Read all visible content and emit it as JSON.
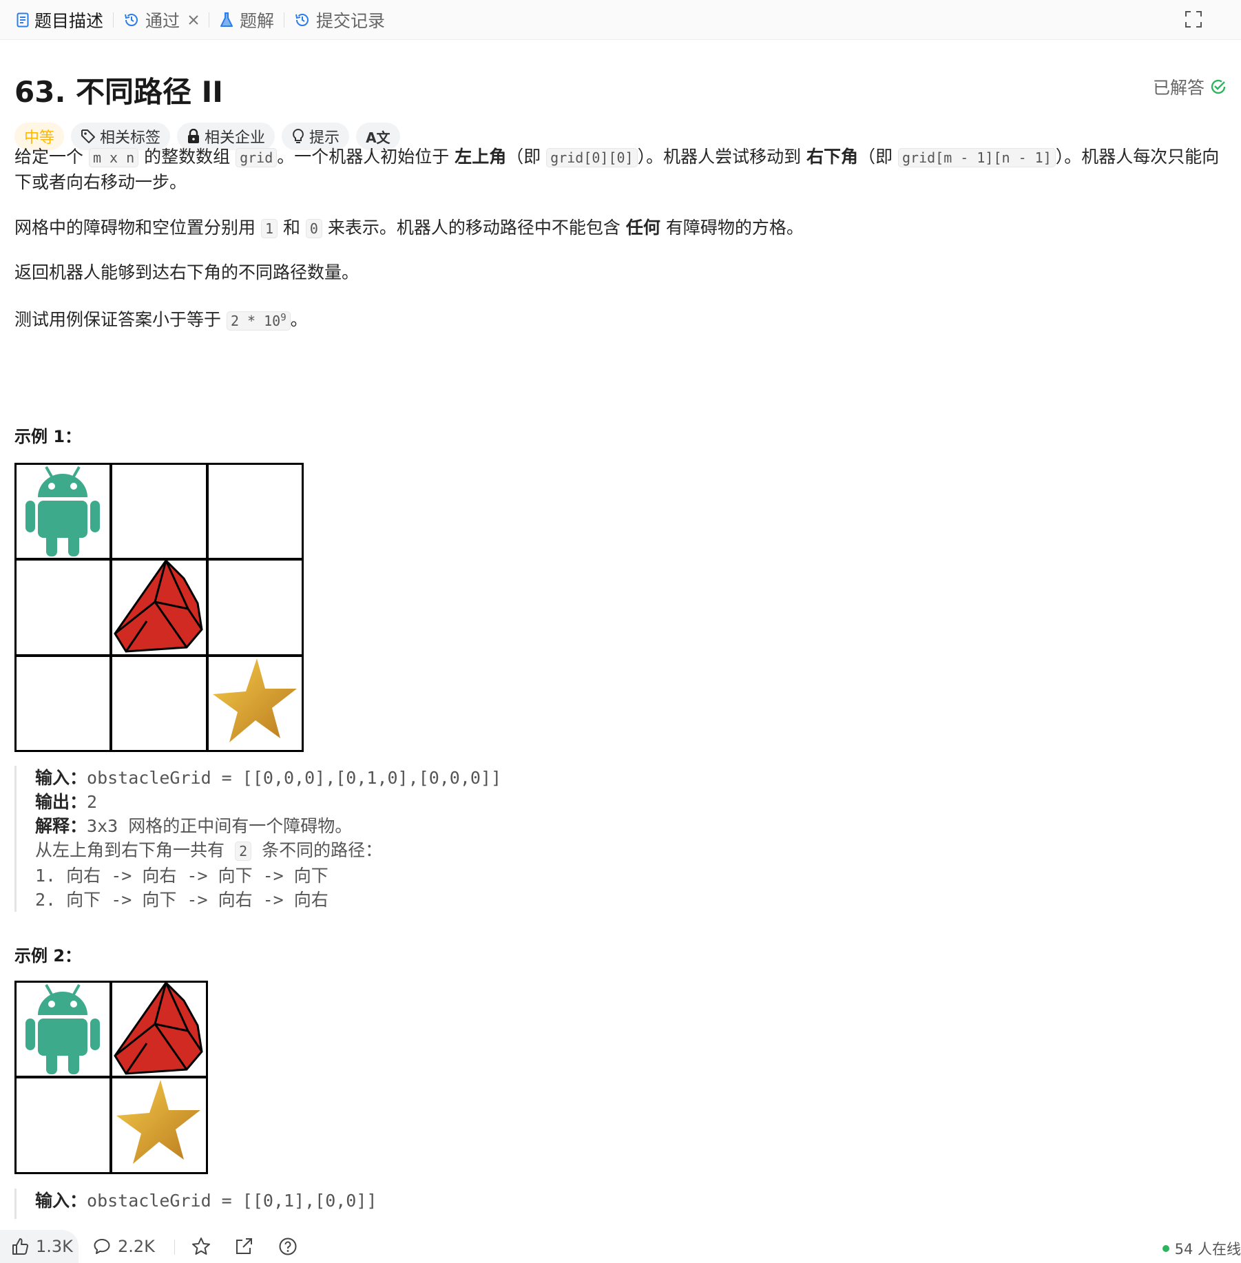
{
  "tabs": [
    {
      "label": "题目描述",
      "icon": "document-icon",
      "active": true
    },
    {
      "label": "通过",
      "icon": "history-icon",
      "closable": true
    },
    {
      "label": "题解",
      "icon": "flask-icon"
    },
    {
      "label": "提交记录",
      "icon": "history-icon"
    }
  ],
  "problem": {
    "title": "63. 不同路径 II",
    "status": "已解答",
    "difficulty": "中等",
    "tags": [
      "相关标签",
      "相关企业",
      "提示"
    ],
    "translate_icon_label": "A文"
  },
  "description": {
    "p1": {
      "t1": "给定一个 ",
      "c1": "m x n",
      "t2": " 的整数数组 ",
      "c2": "grid",
      "t3": "。一个机器人初始位于 ",
      "b1": "左上角",
      "t4": "（即 ",
      "c3": "grid[0][0]",
      "t5": "）。机器人尝试移动到 ",
      "b2": "右下角",
      "t6": "（即 ",
      "c4": "grid[m - 1][n - 1]",
      "t7": "）。机器人每次只能向下或者向右移动一步。"
    },
    "p2": {
      "t1": "网格中的障碍物和空位置分别用 ",
      "c1": "1",
      "t2": " 和 ",
      "c2": "0",
      "t3": " 来表示。机器人的移动路径中不能包含 ",
      "b1": "任何",
      "t4": " 有障碍物的方格。"
    },
    "p3": "返回机器人能够到达右下角的不同路径数量。",
    "p4": {
      "t1": "测试用例保证答案小于等于 ",
      "c_base": "2 * 10",
      "c_exp": "9",
      "t2": "。"
    }
  },
  "examples": [
    {
      "heading": "示例 1：",
      "input_label": "输入：",
      "input": "obstacleGrid = [[0,0,0],[0,1,0],[0,0,0]]",
      "output_label": "输出：",
      "output": "2",
      "explain_label": "解释：",
      "explain": "3x3 网格的正中间有一个障碍物。",
      "path_intro_a": "从左上角到右下角一共有 ",
      "path_count": "2",
      "path_intro_b": " 条不同的路径：",
      "path1": "1. 向右 -> 向右 -> 向下 -> 向下",
      "path2": "2. 向下 -> 向下 -> 向右 -> 向右"
    },
    {
      "heading": "示例 2：",
      "input_label": "输入：",
      "input": "obstacleGrid = [[0,1],[0,0]]"
    }
  ],
  "bottom": {
    "likes": "1.3K",
    "comments": "2.2K",
    "online": "54 人在线"
  },
  "colors": {
    "robot": "#3DAA8C",
    "obstacle": "#D12A22",
    "star": "#E0A62A",
    "difficulty": "#FFB800",
    "solved_check": "#2DB55D"
  }
}
